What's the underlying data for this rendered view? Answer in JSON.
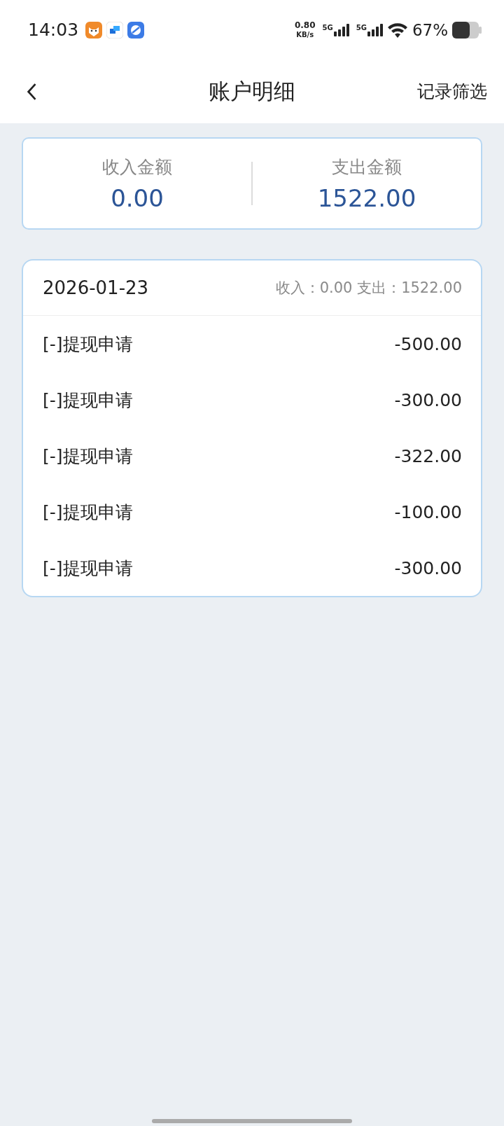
{
  "status_bar": {
    "time": "14:03",
    "net_speed": "0.80",
    "net_unit": "KB/s",
    "networks": [
      "5G",
      "5G"
    ],
    "battery": "67%"
  },
  "header": {
    "title": "账户明细",
    "action": "记录筛选"
  },
  "summary": [
    {
      "label": "收入金额",
      "amount": "0.00"
    },
    {
      "label": "支出金额",
      "amount": "1522.00"
    }
  ],
  "day": {
    "date": "2026-01-23",
    "totals": "收入：0.00 支出：1522.00",
    "records": [
      {
        "title": "[-]提现申请",
        "amount": "-500.00"
      },
      {
        "title": "[-]提现申请",
        "amount": "-300.00"
      },
      {
        "title": "[-]提现申请",
        "amount": "-322.00"
      },
      {
        "title": "[-]提现申请",
        "amount": "-100.00"
      },
      {
        "title": "[-]提现申请",
        "amount": "-300.00"
      }
    ]
  }
}
